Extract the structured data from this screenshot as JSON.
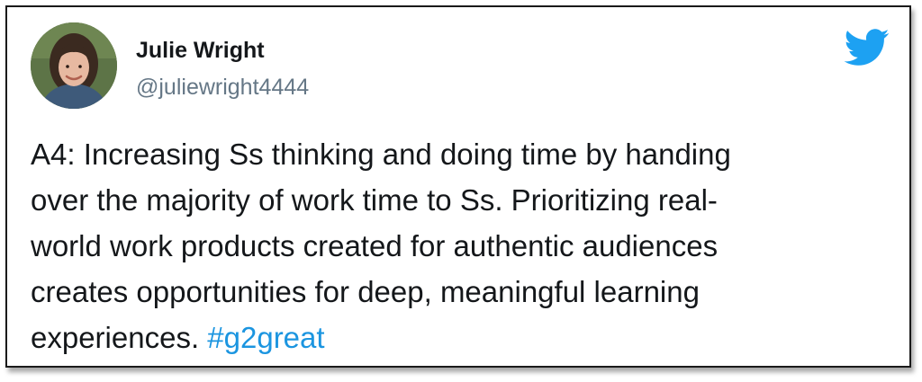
{
  "tweet": {
    "author": {
      "display_name": "Julie Wright",
      "handle": "@juliewright4444"
    },
    "text_lines": [
      "A4: Increasing Ss thinking and doing time by handing",
      "over the majority of work time to Ss. Prioritizing real-",
      "world work products created for authentic audiences",
      "creates opportunities for deep, meaningful learning",
      "experiences. "
    ],
    "hashtag": "#g2great"
  },
  "colors": {
    "name": "#14171a",
    "handle": "#657786",
    "hashtag": "#1b95e0",
    "twitter_brand": "#1da1f2"
  },
  "icons": {
    "brand": "twitter-bird-icon"
  }
}
